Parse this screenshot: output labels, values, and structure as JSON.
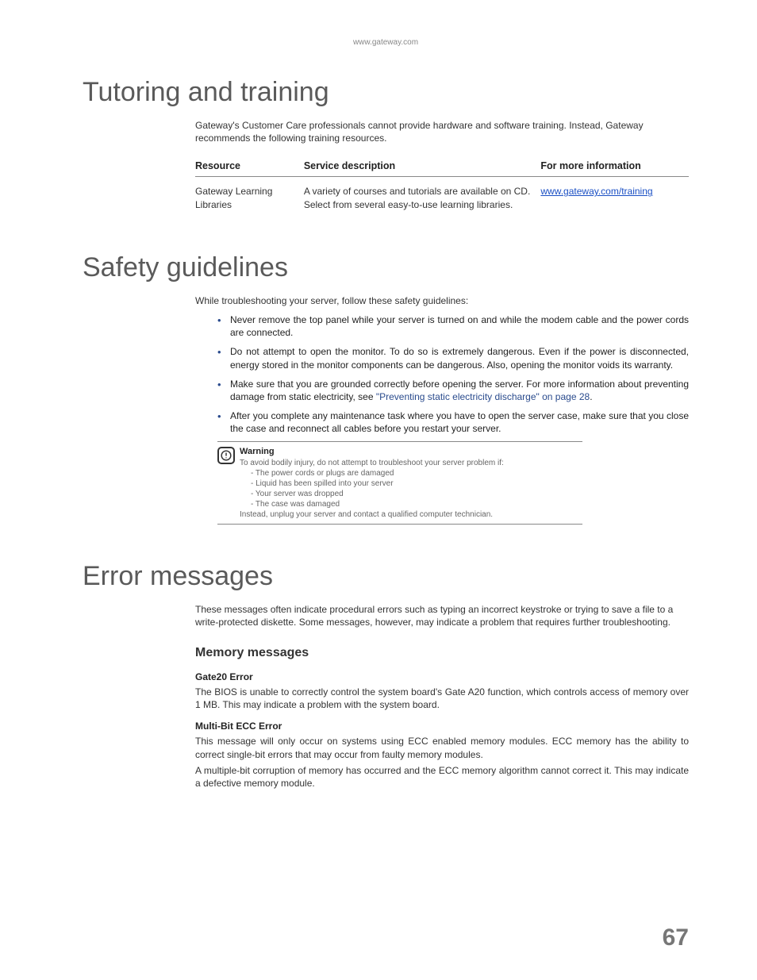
{
  "header": {
    "url": "www.gateway.com"
  },
  "sections": {
    "tutoring": {
      "title": "Tutoring and training",
      "intro": "Gateway's Customer Care professionals cannot provide hardware and software training. Instead, Gateway recommends the following training resources.",
      "table": {
        "headers": [
          "Resource",
          "Service description",
          "For more information"
        ],
        "row": {
          "resource": "Gateway Learning Libraries",
          "desc": "A variety of courses and tutorials are available on CD. Select from several easy-to-use learning libraries.",
          "link": "www.gateway.com/training"
        }
      }
    },
    "safety": {
      "title": "Safety guidelines",
      "intro": "While troubleshooting your server, follow these safety guidelines:",
      "bullets": [
        "Never remove the top panel while your server is turned on and while the modem cable and the power cords are connected.",
        "Do not attempt to open the monitor. To do so is extremely dangerous. Even if the power is disconnected, energy stored in the monitor components can be dangerous. Also, opening the monitor voids its warranty."
      ],
      "bullet3_pre": "Make sure that you are grounded correctly before opening the server. For more information about preventing damage from static electricity, see ",
      "bullet3_link": "\"Preventing static electricity discharge\" on page 28",
      "bullet3_post": ".",
      "bullet4": "After you complete any maintenance task where you have to open the server case, make sure that you close the case and reconnect all cables before you restart your server.",
      "warning": {
        "title": "Warning",
        "lead": "To avoid bodily injury, do not attempt to troubleshoot your server problem if:",
        "items": [
          "- The power cords or plugs are damaged",
          "- Liquid has been spilled into your server",
          "- Your server was dropped",
          "- The case was damaged"
        ],
        "tail": "Instead, unplug your server and contact a qualified computer technician."
      }
    },
    "errors": {
      "title": "Error messages",
      "intro": "These messages often indicate procedural errors such as typing an incorrect keystroke or trying to save a file to a write-protected diskette. Some messages, however, may indicate a problem that requires further troubleshooting.",
      "memory": {
        "title": "Memory messages",
        "gate20": {
          "title": "Gate20 Error",
          "body": "The BIOS is unable to correctly control the system board's Gate A20 function, which controls access of memory over 1 MB. This may indicate a problem with the system board."
        },
        "multibit": {
          "title": "Multi-Bit ECC Error",
          "body1": "This message will only occur on systems using ECC enabled memory modules. ECC memory has the ability to correct single-bit errors that may occur from faulty memory modules.",
          "body2": "A multiple-bit corruption of memory has occurred and the ECC memory algorithm cannot correct it. This may indicate a defective memory module."
        }
      }
    }
  },
  "page_number": "67"
}
